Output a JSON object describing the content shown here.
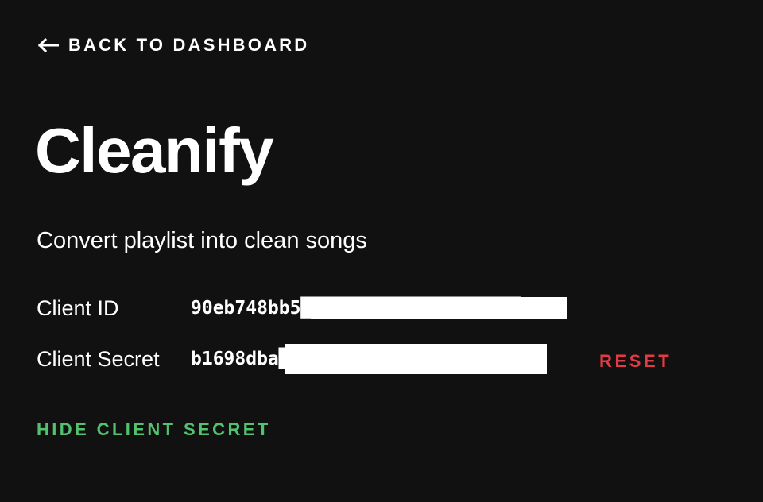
{
  "nav": {
    "back_label": "BACK TO DASHBOARD",
    "back_icon": "arrow-left-icon"
  },
  "app": {
    "title": "Cleanify",
    "description": "Convert playlist into clean songs"
  },
  "credentials": {
    "client_id_label": "Client ID",
    "client_id_value": "90eb748bb5████████████████████e4",
    "client_secret_label": "Client Secret",
    "client_secret_value": "b1698dba████████████████████b08",
    "reset_label": "RESET",
    "toggle_secret_label": "HIDE CLIENT SECRET"
  },
  "colors": {
    "background": "#111111",
    "text": "#ffffff",
    "danger": "#e13b45",
    "accent": "#53c26f"
  }
}
